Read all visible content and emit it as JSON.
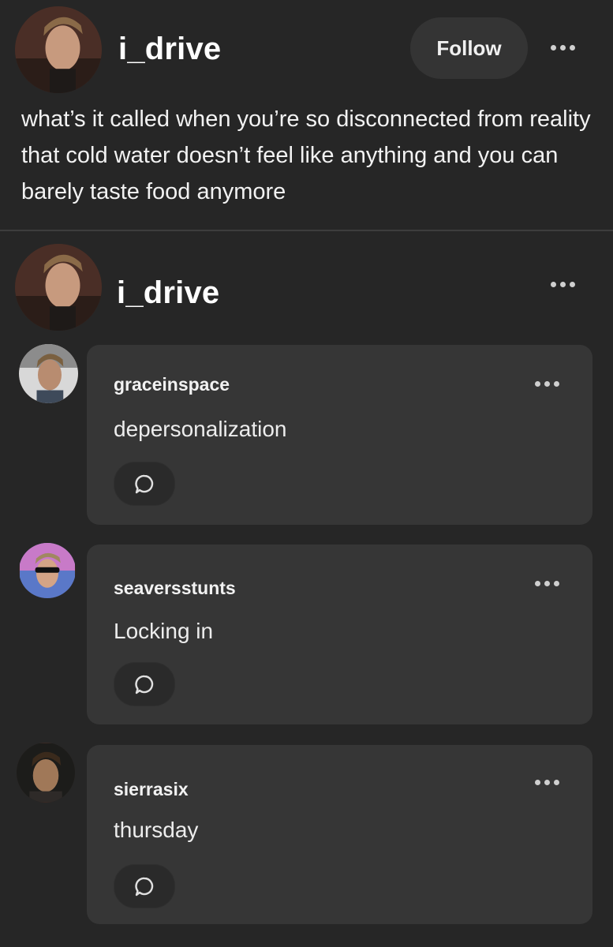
{
  "post": {
    "username": "i_drive",
    "follow_label": "Follow",
    "more_icon": "more-dots-icon",
    "text": "what’s it called when you’re so disconnected from reality that cold water doesn’t feel like anything and you can barely taste food anymore"
  },
  "reblog": {
    "username": "i_drive",
    "more_icon": "more-dots-icon"
  },
  "replies": [
    {
      "username": "graceinspace",
      "text": "depersonalization",
      "reply_icon": "speech-bubble-icon"
    },
    {
      "username": "seaversstunts",
      "text": "Locking in",
      "reply_icon": "speech-bubble-icon"
    },
    {
      "username": "sierrasix",
      "text": "thursday",
      "reply_icon": "speech-bubble-icon"
    }
  ],
  "colors": {
    "background": "#262626",
    "card": "#363636",
    "button": "#343434",
    "text": "#f2f2f2"
  }
}
